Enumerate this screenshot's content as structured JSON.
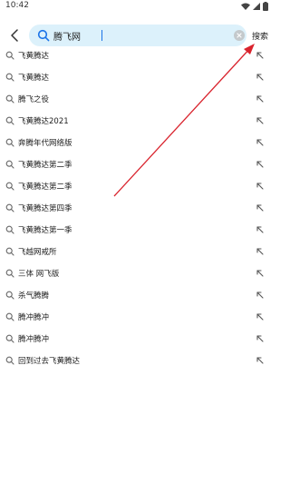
{
  "status_bar": {
    "time": "10:42",
    "icons": [
      "wifi-icon",
      "signal-icon",
      "battery-icon"
    ]
  },
  "header": {
    "back_icon": "chevron-left-icon",
    "search": {
      "icon": "search-icon",
      "value": "腾飞网",
      "clear_icon": "clear-icon"
    },
    "submit_label": "搜索"
  },
  "suggestions": [
    {
      "label": "飞黄腾达"
    },
    {
      "label": "飞黄腾达"
    },
    {
      "label": "腾飞之役"
    },
    {
      "label": "飞黄腾达2021"
    },
    {
      "label": "奔腾年代网络版"
    },
    {
      "label": "飞黄腾达第二季"
    },
    {
      "label": "飞黄腾达第二季"
    },
    {
      "label": "飞黄腾达第四季"
    },
    {
      "label": "飞黄腾达第一季"
    },
    {
      "label": "飞越网戒所"
    },
    {
      "label": "三体 网飞版"
    },
    {
      "label": "杀气腾腾"
    },
    {
      "label": "腾冲腾冲"
    },
    {
      "label": "腾冲腾冲"
    },
    {
      "label": "回到过去飞黄腾达"
    }
  ],
  "colors": {
    "search_box_bg": "#dcf1fb",
    "accent": "#1a73e8",
    "annotation_arrow": "#d9232d"
  }
}
